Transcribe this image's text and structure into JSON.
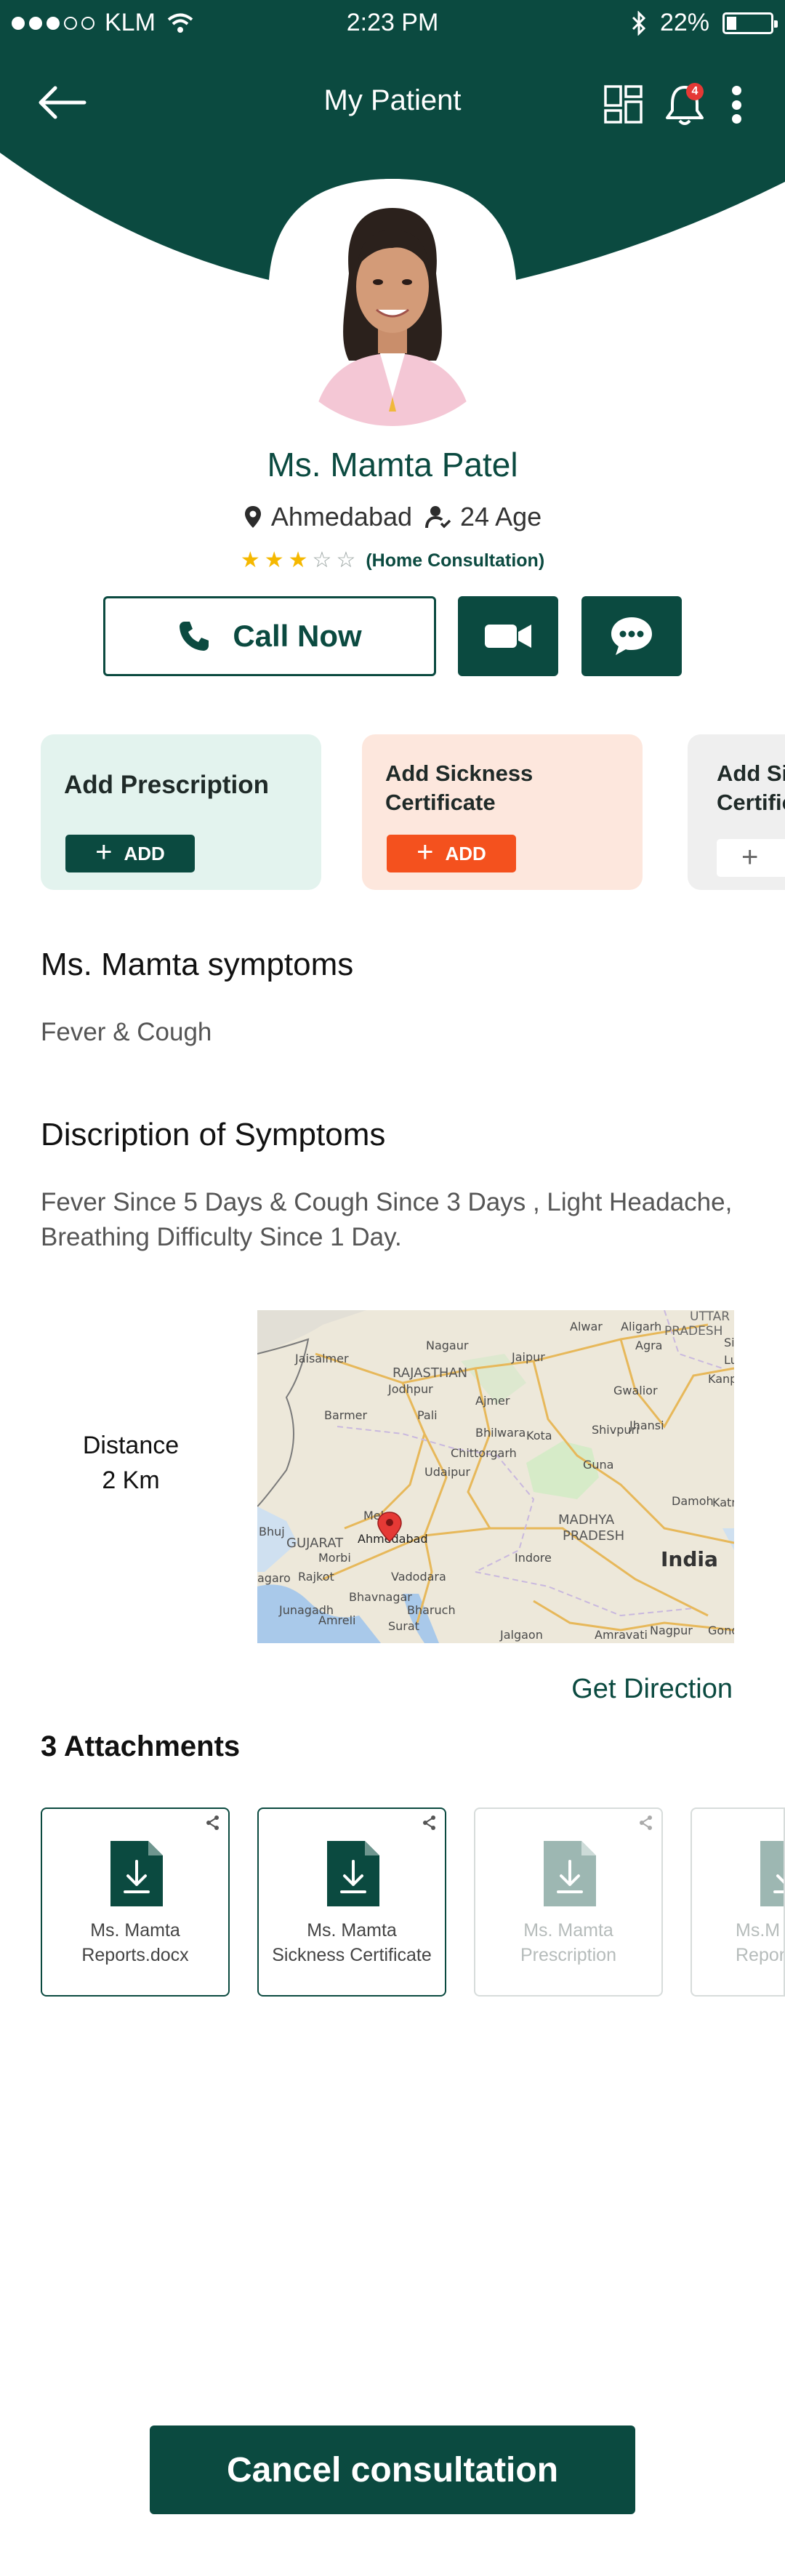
{
  "status_bar": {
    "carrier": "KLM",
    "time": "2:23 PM",
    "battery": "22%",
    "battery_level": 0.22
  },
  "header": {
    "title": "My Patient",
    "notification_count": "4"
  },
  "patient": {
    "name": "Ms. Mamta Patel",
    "city": "Ahmedabad",
    "age": "24 Age",
    "rating": 3,
    "rating_max": 5,
    "consultation": "(Home Consultation)"
  },
  "actions": {
    "call_label": "Call Now"
  },
  "cards": [
    {
      "title": "Add Prescription",
      "button": "ADD",
      "bg": "#e3f3ee",
      "btn_bg": "#0b4a40"
    },
    {
      "title": "Add Sickness Certificate",
      "button": "ADD",
      "bg": "#fde7dd",
      "btn_bg": "#f4511e"
    },
    {
      "title": "Add Si Certific",
      "button": ""
    }
  ],
  "symptoms": {
    "title": "Ms. Mamta symptoms",
    "text": "Fever & Cough"
  },
  "description": {
    "title": "Discription of Symptoms",
    "line1": "Fever Since 5 Days & Cough Since 3 Days , Light Headache,",
    "line2": "Breathing Difficulty Since 1 Day."
  },
  "distance": {
    "label": "Distance",
    "value": "2 Km"
  },
  "map": {
    "labels": [
      "UTTAR",
      "PRADESH",
      "Aligarh",
      "Agra",
      "Alwar",
      "Jaipur",
      "Nagaur",
      "RAJASTHAN",
      "Jaisalmer",
      "Jodhpur",
      "Barmer",
      "Pali",
      "Ajmer",
      "Bhilwara",
      "Kota",
      "Chittorgarh",
      "Udaipur",
      "Gwalior",
      "Shivpuri",
      "Jhansi",
      "Guna",
      "Kanpur",
      "Sit",
      "Lu",
      "Damoh",
      "Katn",
      "MADHYA",
      "PRADESH",
      "India",
      "Mehs",
      "GUJARAT",
      "Ahmedabad",
      "Morbi",
      "Rajkot",
      "Vadodara",
      "Indore",
      "Bhavnagar",
      "Bharuch",
      "Junagadh",
      "Amreli",
      "Surat",
      "Jalgaon",
      "Amravati",
      "Nagpur",
      "Gondia",
      "Bhuj",
      "agaro"
    ]
  },
  "get_direction": "Get Direction",
  "attachments": {
    "title": "3 Attachments",
    "items": [
      {
        "line1": "Ms. Mamta",
        "line2": "Reports.docx",
        "active": true
      },
      {
        "line1": "Ms. Mamta",
        "line2": "Sickness Certificate",
        "active": true
      },
      {
        "line1": "Ms. Mamta",
        "line2": "Prescription",
        "active": false
      },
      {
        "line1": "Ms.M",
        "line2": "Report",
        "active": false
      }
    ]
  },
  "footer": {
    "cancel_label": "Cancel consultation"
  },
  "colors": {
    "primary": "#0b4a40",
    "accent_orange": "#f4511e",
    "star": "#f5b800",
    "badge": "#e53935"
  },
  "icons": [
    "back-arrow-icon",
    "grid-icon",
    "bell-icon",
    "more-vertical-icon",
    "map-pin-icon",
    "person-icon",
    "phone-icon",
    "video-icon",
    "chat-icon",
    "plus-icon",
    "download-file-icon",
    "share-icon",
    "wifi-icon",
    "bluetooth-icon",
    "battery-icon"
  ]
}
